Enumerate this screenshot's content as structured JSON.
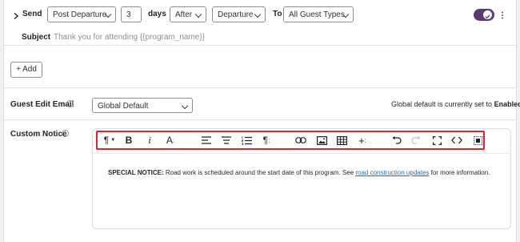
{
  "send_row": {
    "send_label": "Send",
    "trigger_value": "Post Departure",
    "days_count": "3",
    "days_label": "days",
    "timing_value": "After",
    "reference_value": "Departure",
    "to_label": "To",
    "guest_types_value": "All Guest Types",
    "toggle_on": true
  },
  "subject": {
    "label": "Subject",
    "placeholder": "Thank you for attending {{program_name}}"
  },
  "add_button": {
    "label": "+ Add"
  },
  "guest_edit_email": {
    "label": "Guest Edit Email",
    "value": "Global Default",
    "note_prefix": "Global default is currently set to",
    "note_value": "Enabled"
  },
  "custom_notice": {
    "label": "Custom Notice",
    "toolbar_icons": [
      "paragraph-format-icon",
      "bold-icon",
      "italic-icon",
      "font-size-icon",
      "align-left-icon",
      "align-center-icon",
      "ordered-list-icon",
      "paragraph-style-icon",
      "link-icon",
      "image-icon",
      "table-icon",
      "insert-hr-icon",
      "undo-icon",
      "redo-icon",
      "fullscreen-icon",
      "code-view-icon",
      "select-all-icon"
    ],
    "body_bold": "SPECIAL NOTICE:",
    "body_text": " Road work is scheduled around the start date of this program. See ",
    "body_link": "road construction updates",
    "body_tail": " for more information."
  },
  "colors": {
    "toggle": "#5b3a72",
    "highlight": "#d9262d",
    "link": "#2271b1"
  }
}
